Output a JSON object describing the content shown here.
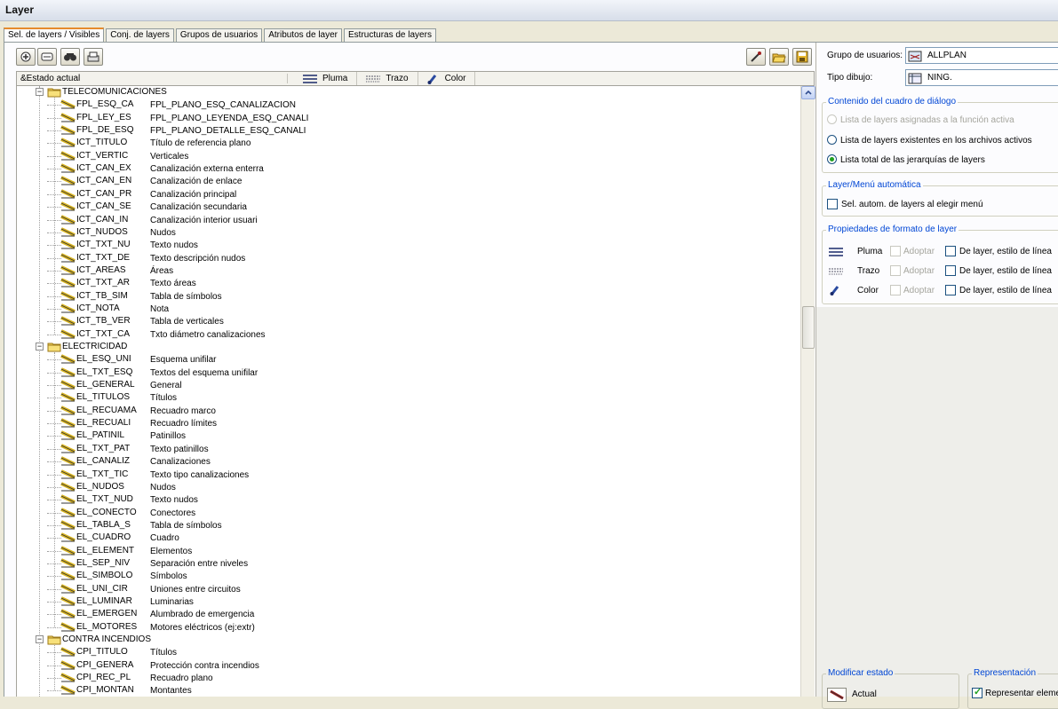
{
  "window": {
    "title": "Layer"
  },
  "tabs": [
    "Sel. de layers / Visibles",
    "Conj. de layers",
    "Grupos de usuarios",
    "Atributos de layer",
    "Estructuras de layers"
  ],
  "toolbar": {
    "left_icons": [
      "new-layer-icon",
      "layer-list-icon",
      "find-icon",
      "print-icon"
    ],
    "right_icons": [
      "pipette-icon",
      "open-folder-icon",
      "save-icon"
    ]
  },
  "header": {
    "state_col": "&Estado actual",
    "pen": "Pluma",
    "stroke": "Trazo",
    "color": "Color"
  },
  "tree": [
    {
      "type": "group",
      "name": "TELECOMUNICACIONES"
    },
    {
      "type": "layer",
      "name": "FPL_ESQ_CA",
      "desc": "FPL_PLANO_ESQ_CANALIZACION"
    },
    {
      "type": "layer",
      "name": "FPL_LEY_ES",
      "desc": "FPL_PLANO_LEYENDA_ESQ_CANALI"
    },
    {
      "type": "layer",
      "name": "FPL_DE_ESQ",
      "desc": "FPL_PLANO_DETALLE_ESQ_CANALI"
    },
    {
      "type": "layer",
      "name": "ICT_TITULO",
      "desc": "Título de referencia plano"
    },
    {
      "type": "layer",
      "name": "ICT_VERTIC",
      "desc": "Verticales"
    },
    {
      "type": "layer",
      "name": "ICT_CAN_EX",
      "desc": "Canalización externa enterra"
    },
    {
      "type": "layer",
      "name": "ICT_CAN_EN",
      "desc": "Canalización de enlace"
    },
    {
      "type": "layer",
      "name": "ICT_CAN_PR",
      "desc": "Canalización principal"
    },
    {
      "type": "layer",
      "name": "ICT_CAN_SE",
      "desc": "Canalización secundaria"
    },
    {
      "type": "layer",
      "name": "ICT_CAN_IN",
      "desc": "Canalización interior usuari"
    },
    {
      "type": "layer",
      "name": "ICT_NUDOS",
      "desc": "Nudos"
    },
    {
      "type": "layer",
      "name": "ICT_TXT_NU",
      "desc": "Texto nudos"
    },
    {
      "type": "layer",
      "name": "ICT_TXT_DE",
      "desc": "Texto descripción nudos"
    },
    {
      "type": "layer",
      "name": "ICT_AREAS",
      "desc": "Áreas"
    },
    {
      "type": "layer",
      "name": "ICT_TXT_AR",
      "desc": "Texto áreas"
    },
    {
      "type": "layer",
      "name": "ICT_TB_SIM",
      "desc": "Tabla de símbolos"
    },
    {
      "type": "layer",
      "name": "ICT_NOTA",
      "desc": "Nota"
    },
    {
      "type": "layer",
      "name": "ICT_TB_VER",
      "desc": "Tabla de verticales"
    },
    {
      "type": "layer",
      "name": "ICT_TXT_CA",
      "desc": "Txto diámetro canalizaciones"
    },
    {
      "type": "group",
      "name": "ELECTRICIDAD"
    },
    {
      "type": "layer",
      "name": "EL_ESQ_UNI",
      "desc": "Esquema unifilar"
    },
    {
      "type": "layer",
      "name": "EL_TXT_ESQ",
      "desc": "Textos del esquema unifilar"
    },
    {
      "type": "layer",
      "name": "EL_GENERAL",
      "desc": "General"
    },
    {
      "type": "layer",
      "name": "EL_TITULOS",
      "desc": "Títulos"
    },
    {
      "type": "layer",
      "name": "EL_RECUAMA",
      "desc": "Recuadro marco"
    },
    {
      "type": "layer",
      "name": "EL_RECUALI",
      "desc": "Recuadro límites"
    },
    {
      "type": "layer",
      "name": "EL_PATINIL",
      "desc": "Patinillos"
    },
    {
      "type": "layer",
      "name": "EL_TXT_PAT",
      "desc": "Texto patinillos"
    },
    {
      "type": "layer",
      "name": "EL_CANALIZ",
      "desc": "Canalizaciones"
    },
    {
      "type": "layer",
      "name": "EL_TXT_TIC",
      "desc": "Texto tipo canalizaciones"
    },
    {
      "type": "layer",
      "name": "EL_NUDOS",
      "desc": "Nudos"
    },
    {
      "type": "layer",
      "name": "EL_TXT_NUD",
      "desc": "Texto nudos"
    },
    {
      "type": "layer",
      "name": "EL_CONECTO",
      "desc": "Conectores"
    },
    {
      "type": "layer",
      "name": "EL_TABLA_S",
      "desc": "Tabla de símbolos"
    },
    {
      "type": "layer",
      "name": "EL_CUADRO",
      "desc": "Cuadro"
    },
    {
      "type": "layer",
      "name": "EL_ELEMENT",
      "desc": "Elementos"
    },
    {
      "type": "layer",
      "name": "EL_SEP_NIV",
      "desc": "Separación entre niveles"
    },
    {
      "type": "layer",
      "name": "EL_SIMBOLO",
      "desc": "Símbolos"
    },
    {
      "type": "layer",
      "name": "EL_UNI_CIR",
      "desc": "Uniones entre circuitos"
    },
    {
      "type": "layer",
      "name": "EL_LUMINAR",
      "desc": "Luminarias"
    },
    {
      "type": "layer",
      "name": "EL_EMERGEN",
      "desc": "Alumbrado de emergencia"
    },
    {
      "type": "layer",
      "name": "EL_MOTORES",
      "desc": "Motores eléctricos (ej:extr)"
    },
    {
      "type": "group",
      "name": "CONTRA INCENDIOS"
    },
    {
      "type": "layer",
      "name": "CPI_TITULO",
      "desc": "Títulos"
    },
    {
      "type": "layer",
      "name": "CPI_GENERA",
      "desc": "Protección contra incendios"
    },
    {
      "type": "layer",
      "name": "CPI_REC_PL",
      "desc": "Recuadro plano"
    },
    {
      "type": "layer",
      "name": "CPI_MONTAN",
      "desc": "Montantes"
    }
  ],
  "side": {
    "user_group_label": "Grupo de usuarios:",
    "user_group_value": "ALLPLAN",
    "drawing_type_label": "Tipo dibujo:",
    "drawing_type_value": "NING.",
    "dialog_content": {
      "title": "Contenido del cuadro de diálogo",
      "options": [
        "Lista de layers asignadas a la función activa",
        "Lista de layers existentes en los archivos activos",
        "Lista total de las  jerarquías de layers"
      ],
      "selected_index": 2
    },
    "auto_menu": {
      "title": "Layer/Menú automática",
      "checkbox": "Sel. autom. de layers al elegir menú"
    },
    "format_props": {
      "title": "Propiedades de formato de layer",
      "rows": [
        {
          "label": "Pluma",
          "adopt": "Adoptar",
          "by_layer": "De layer, estilo de línea"
        },
        {
          "label": "Trazo",
          "adopt": "Adoptar",
          "by_layer": "De layer, estilo de línea"
        },
        {
          "label": "Color",
          "adopt": "Adoptar",
          "by_layer": "De layer, estilo de línea"
        }
      ]
    },
    "modify_state": {
      "title": "Modificar estado",
      "button": "Actual"
    },
    "representation": {
      "title": "Representación",
      "checkbox": "Representar elemen"
    }
  }
}
